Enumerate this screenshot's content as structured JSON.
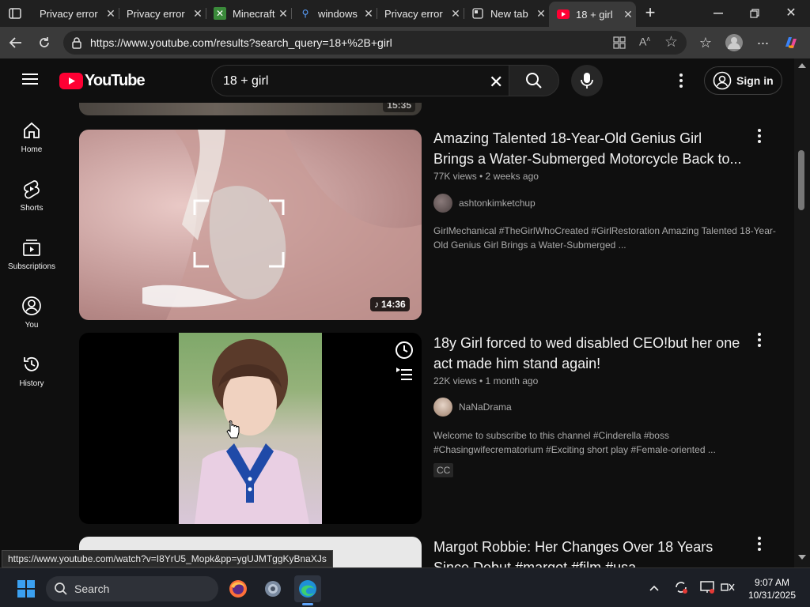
{
  "browser": {
    "tabs": [
      {
        "label": "Privacy error",
        "icon": "warning-icon"
      },
      {
        "label": "Privacy error",
        "icon": "warning-icon"
      },
      {
        "label": "Minecraft",
        "icon": "minecraft-icon"
      },
      {
        "label": "windows",
        "icon": "search-icon"
      },
      {
        "label": "Privacy error",
        "icon": "warning-icon"
      },
      {
        "label": "New tab",
        "icon": "newtab-icon"
      },
      {
        "label": "18 + girl",
        "icon": "youtube-icon"
      }
    ],
    "url": "https://www.youtube.com/results?search_query=18+%2B+girl",
    "new_tab_symbol": "+"
  },
  "youtube": {
    "logo_text": "YouTube",
    "search_query": "18 + girl",
    "sign_in": "Sign in",
    "sidebar": [
      {
        "label": "Home",
        "icon": "home-icon"
      },
      {
        "label": "Shorts",
        "icon": "shorts-icon"
      },
      {
        "label": "Subscriptions",
        "icon": "subscriptions-icon"
      },
      {
        "label": "You",
        "icon": "you-icon"
      },
      {
        "label": "History",
        "icon": "history-icon"
      }
    ],
    "videos": [
      {
        "title_line1": "Amazing Talented 18-Year-Old Genius Girl",
        "title_line2": "Brings a Water-Submerged Motorcycle Back to...",
        "meta": "77K views • 2 weeks ago",
        "channel": "ashtonkimketchup",
        "desc_line1": "GirlMechanical #TheGirlWhoCreated #GirlRestoration Amazing Talented 18-Year-",
        "desc_line2": "Old Genius Girl Brings a Water-Submerged ...",
        "duration": "14:36"
      },
      {
        "title_line1": "18y Girl forced to wed disabled CEO!but her one",
        "title_line2": "act made him stand again!",
        "meta": "22K views • 1 month ago",
        "channel": "NaNaDrama",
        "desc_line1": "Welcome to subscribe to this channel #Cinderella #boss",
        "desc_line2": "#Chasingwifecrematorium #Exciting short play #Female-oriented ...",
        "badge": "CC"
      },
      {
        "title_line1": "Margot Robbie: Her Changes Over 18 Years",
        "title_line2": "Since Debut #margot #film #usa"
      }
    ],
    "partial_top_duration": "15:35"
  },
  "status_link": "https://www.youtube.com/watch?v=I8YrU5_Mopk&pp=ygUJMTggKyBnaXJs",
  "taskbar": {
    "search_label": "Search",
    "time": "9:07 AM",
    "date": "10/31/2025"
  }
}
